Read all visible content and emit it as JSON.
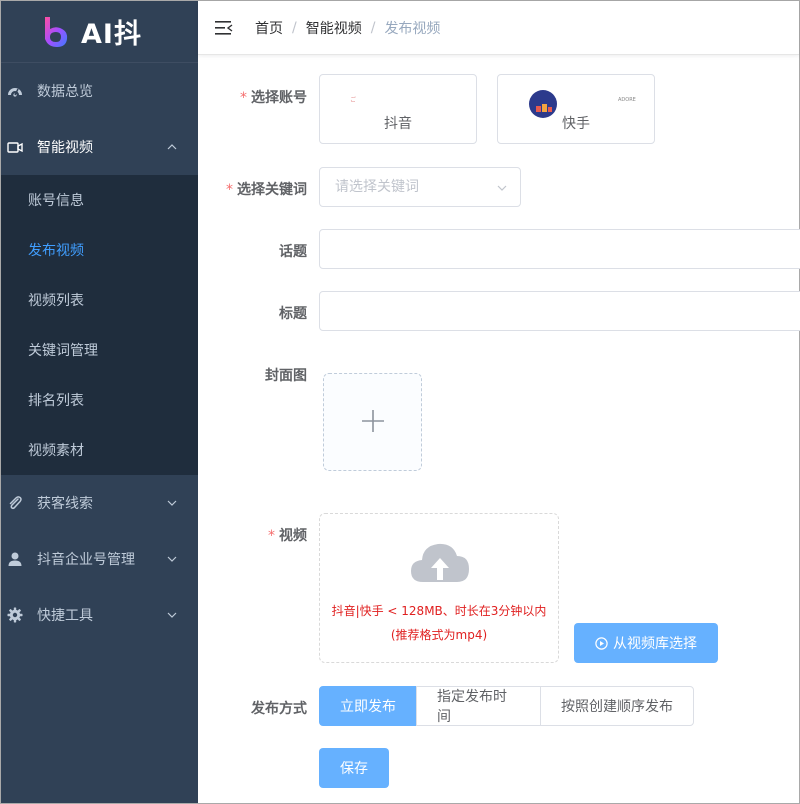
{
  "app": {
    "logo_text": "AI抖"
  },
  "colors": {
    "sidebar_bg": "#304156",
    "submenu_bg": "#1f2d3d",
    "accent": "#409eff",
    "primary_button": "#66b1ff",
    "required": "#f56c6c",
    "upload_tip": "#e02020"
  },
  "sidebar": {
    "items": [
      {
        "label": "数据总览",
        "icon": "dashboard-icon"
      },
      {
        "label": "智能视频",
        "icon": "video-camera-icon",
        "expanded": true
      },
      {
        "label": "获客线索",
        "icon": "paperclip-icon"
      },
      {
        "label": "抖音企业号管理",
        "icon": "user-icon"
      },
      {
        "label": "快捷工具",
        "icon": "gear-icon"
      }
    ],
    "submenu": [
      {
        "label": "账号信息"
      },
      {
        "label": "发布视频",
        "active": true
      },
      {
        "label": "视频列表"
      },
      {
        "label": "关键词管理"
      },
      {
        "label": "排名列表"
      },
      {
        "label": "视频素材"
      }
    ]
  },
  "breadcrumb": {
    "items": [
      "首页",
      "智能视频",
      "发布视频"
    ],
    "separator": "/"
  },
  "form": {
    "account": {
      "label": "选择账号",
      "required_mark": "*",
      "options": [
        {
          "name": "抖音",
          "thumb_text": "ご"
        },
        {
          "name": "快手",
          "thumb_text": "ADORE"
        }
      ]
    },
    "keyword": {
      "label": "选择关键词",
      "required_mark": "*",
      "placeholder": "请选择关键词",
      "value": ""
    },
    "topic": {
      "label": "话题",
      "value": ""
    },
    "title": {
      "label": "标题",
      "value": ""
    },
    "cover": {
      "label": "封面图"
    },
    "video": {
      "label": "视频",
      "required_mark": "*",
      "tip_line1": "抖音|快手 < 128MB、时长在3分钟以内",
      "tip_line2": "(推荐格式为mp4)",
      "library_button": "从视频库选择"
    },
    "publish": {
      "label": "发布方式",
      "options": [
        "立即发布",
        "指定发布时间",
        "按照创建顺序发布"
      ],
      "selected": "立即发布"
    },
    "save_button": "保存"
  }
}
